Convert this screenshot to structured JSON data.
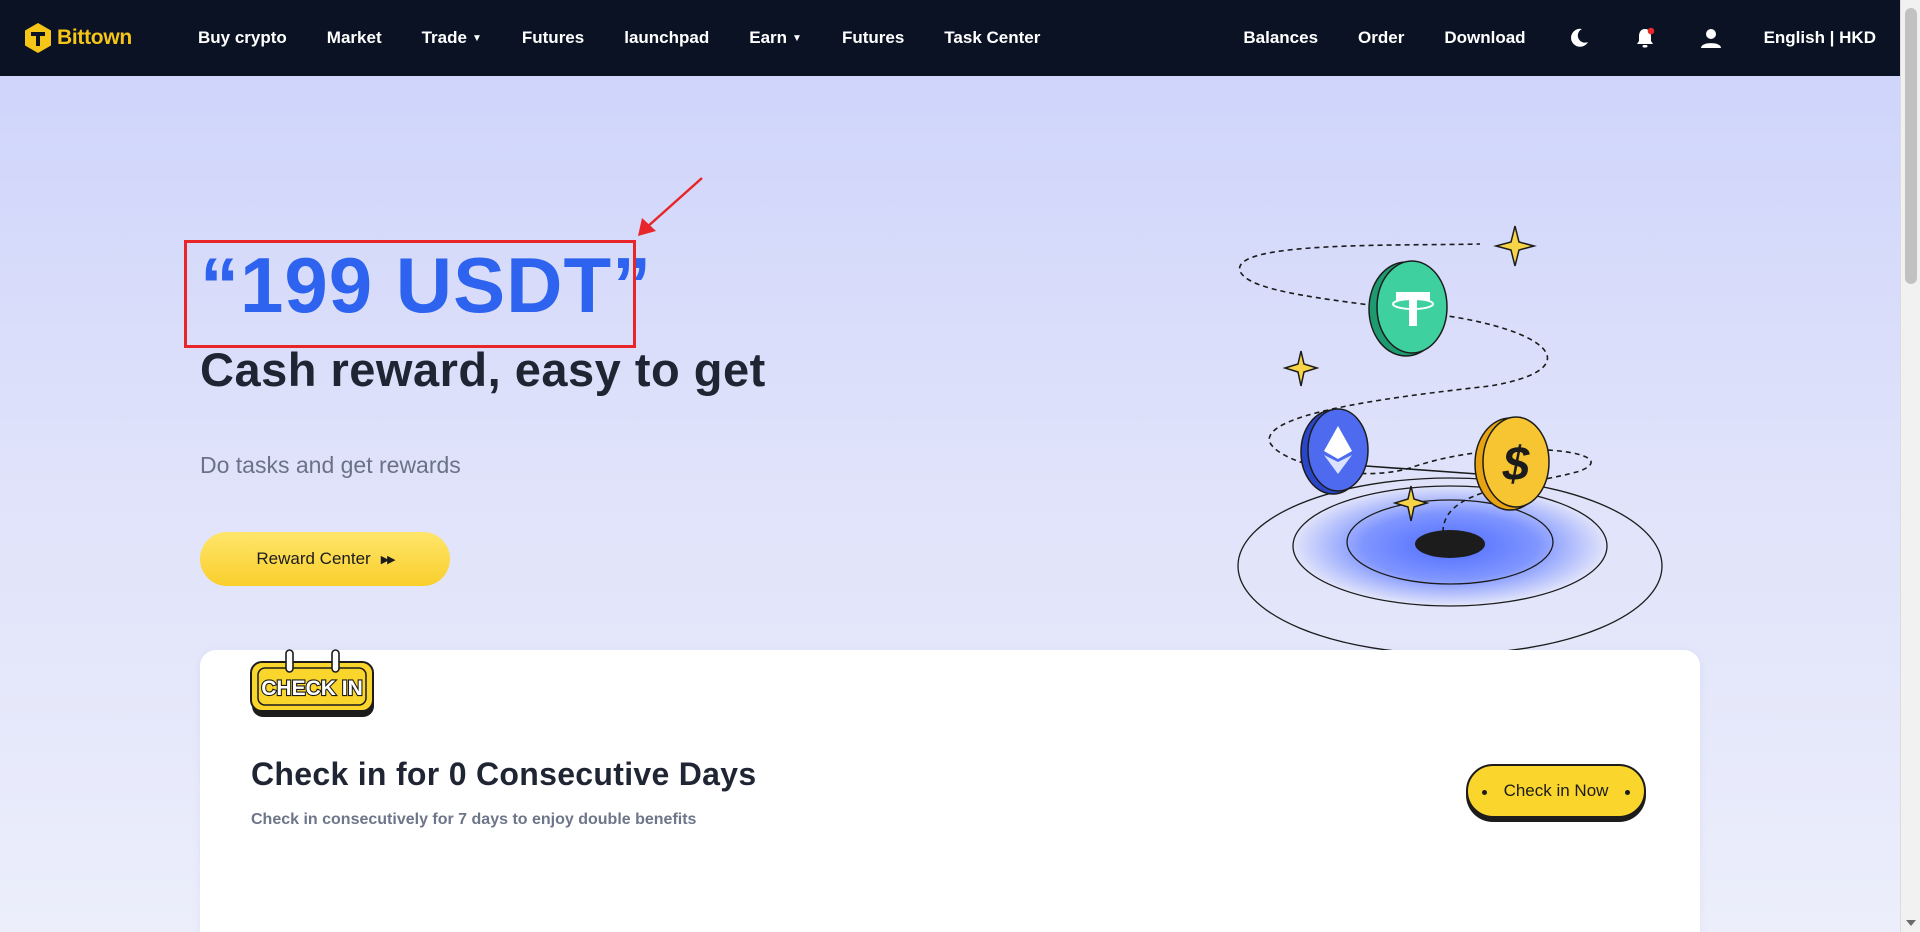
{
  "nav": {
    "logo_text": "Bittown",
    "items": [
      {
        "label": "Buy crypto",
        "dropdown": false
      },
      {
        "label": "Market",
        "dropdown": false
      },
      {
        "label": "Trade",
        "dropdown": true
      },
      {
        "label": "Futures",
        "dropdown": false
      },
      {
        "label": "launchpad",
        "dropdown": false
      },
      {
        "label": "Earn",
        "dropdown": true
      },
      {
        "label": "Futures",
        "dropdown": false
      },
      {
        "label": "Task Center",
        "dropdown": false
      }
    ],
    "right": {
      "balances": "Balances",
      "order": "Order",
      "download": "Download",
      "language_currency": "English | HKD"
    },
    "icons": [
      "moon-icon",
      "bell-icon",
      "user-icon"
    ],
    "accent": "#f5c518",
    "background": "#0a1224"
  },
  "hero": {
    "amount": "“199 USDT”",
    "title": "Cash reward, easy to get",
    "subtitle": "Do tasks and get rewards",
    "button_label": "Reward Center",
    "amount_color": "#2d63ef",
    "annotation_color": "#e8262a"
  },
  "checkin": {
    "badge_text": "CHECK IN",
    "title": "Check in for 0 Consecutive Days",
    "description": "Check in consecutively for 7 days to enjoy double benefits",
    "button_label": "Check in Now",
    "button_color": "#fad52b"
  }
}
